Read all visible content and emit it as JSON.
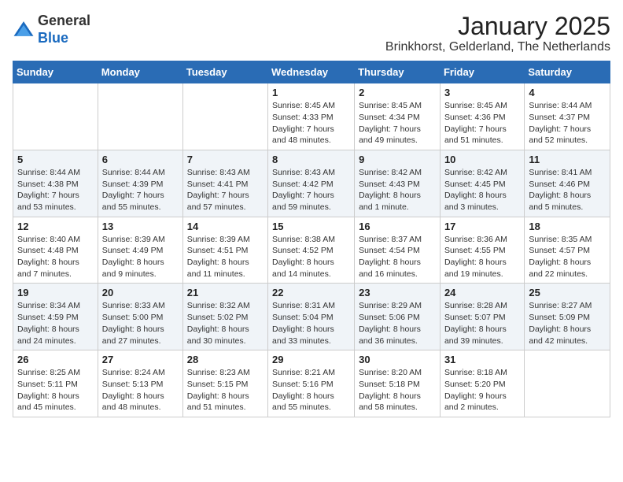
{
  "logo": {
    "general": "General",
    "blue": "Blue"
  },
  "title": "January 2025",
  "location": "Brinkhorst, Gelderland, The Netherlands",
  "days_of_week": [
    "Sunday",
    "Monday",
    "Tuesday",
    "Wednesday",
    "Thursday",
    "Friday",
    "Saturday"
  ],
  "weeks": [
    [
      {
        "day": "",
        "info": ""
      },
      {
        "day": "",
        "info": ""
      },
      {
        "day": "",
        "info": ""
      },
      {
        "day": "1",
        "info": "Sunrise: 8:45 AM\nSunset: 4:33 PM\nDaylight: 7 hours\nand 48 minutes."
      },
      {
        "day": "2",
        "info": "Sunrise: 8:45 AM\nSunset: 4:34 PM\nDaylight: 7 hours\nand 49 minutes."
      },
      {
        "day": "3",
        "info": "Sunrise: 8:45 AM\nSunset: 4:36 PM\nDaylight: 7 hours\nand 51 minutes."
      },
      {
        "day": "4",
        "info": "Sunrise: 8:44 AM\nSunset: 4:37 PM\nDaylight: 7 hours\nand 52 minutes."
      }
    ],
    [
      {
        "day": "5",
        "info": "Sunrise: 8:44 AM\nSunset: 4:38 PM\nDaylight: 7 hours\nand 53 minutes."
      },
      {
        "day": "6",
        "info": "Sunrise: 8:44 AM\nSunset: 4:39 PM\nDaylight: 7 hours\nand 55 minutes."
      },
      {
        "day": "7",
        "info": "Sunrise: 8:43 AM\nSunset: 4:41 PM\nDaylight: 7 hours\nand 57 minutes."
      },
      {
        "day": "8",
        "info": "Sunrise: 8:43 AM\nSunset: 4:42 PM\nDaylight: 7 hours\nand 59 minutes."
      },
      {
        "day": "9",
        "info": "Sunrise: 8:42 AM\nSunset: 4:43 PM\nDaylight: 8 hours\nand 1 minute."
      },
      {
        "day": "10",
        "info": "Sunrise: 8:42 AM\nSunset: 4:45 PM\nDaylight: 8 hours\nand 3 minutes."
      },
      {
        "day": "11",
        "info": "Sunrise: 8:41 AM\nSunset: 4:46 PM\nDaylight: 8 hours\nand 5 minutes."
      }
    ],
    [
      {
        "day": "12",
        "info": "Sunrise: 8:40 AM\nSunset: 4:48 PM\nDaylight: 8 hours\nand 7 minutes."
      },
      {
        "day": "13",
        "info": "Sunrise: 8:39 AM\nSunset: 4:49 PM\nDaylight: 8 hours\nand 9 minutes."
      },
      {
        "day": "14",
        "info": "Sunrise: 8:39 AM\nSunset: 4:51 PM\nDaylight: 8 hours\nand 11 minutes."
      },
      {
        "day": "15",
        "info": "Sunrise: 8:38 AM\nSunset: 4:52 PM\nDaylight: 8 hours\nand 14 minutes."
      },
      {
        "day": "16",
        "info": "Sunrise: 8:37 AM\nSunset: 4:54 PM\nDaylight: 8 hours\nand 16 minutes."
      },
      {
        "day": "17",
        "info": "Sunrise: 8:36 AM\nSunset: 4:55 PM\nDaylight: 8 hours\nand 19 minutes."
      },
      {
        "day": "18",
        "info": "Sunrise: 8:35 AM\nSunset: 4:57 PM\nDaylight: 8 hours\nand 22 minutes."
      }
    ],
    [
      {
        "day": "19",
        "info": "Sunrise: 8:34 AM\nSunset: 4:59 PM\nDaylight: 8 hours\nand 24 minutes."
      },
      {
        "day": "20",
        "info": "Sunrise: 8:33 AM\nSunset: 5:00 PM\nDaylight: 8 hours\nand 27 minutes."
      },
      {
        "day": "21",
        "info": "Sunrise: 8:32 AM\nSunset: 5:02 PM\nDaylight: 8 hours\nand 30 minutes."
      },
      {
        "day": "22",
        "info": "Sunrise: 8:31 AM\nSunset: 5:04 PM\nDaylight: 8 hours\nand 33 minutes."
      },
      {
        "day": "23",
        "info": "Sunrise: 8:29 AM\nSunset: 5:06 PM\nDaylight: 8 hours\nand 36 minutes."
      },
      {
        "day": "24",
        "info": "Sunrise: 8:28 AM\nSunset: 5:07 PM\nDaylight: 8 hours\nand 39 minutes."
      },
      {
        "day": "25",
        "info": "Sunrise: 8:27 AM\nSunset: 5:09 PM\nDaylight: 8 hours\nand 42 minutes."
      }
    ],
    [
      {
        "day": "26",
        "info": "Sunrise: 8:25 AM\nSunset: 5:11 PM\nDaylight: 8 hours\nand 45 minutes."
      },
      {
        "day": "27",
        "info": "Sunrise: 8:24 AM\nSunset: 5:13 PM\nDaylight: 8 hours\nand 48 minutes."
      },
      {
        "day": "28",
        "info": "Sunrise: 8:23 AM\nSunset: 5:15 PM\nDaylight: 8 hours\nand 51 minutes."
      },
      {
        "day": "29",
        "info": "Sunrise: 8:21 AM\nSunset: 5:16 PM\nDaylight: 8 hours\nand 55 minutes."
      },
      {
        "day": "30",
        "info": "Sunrise: 8:20 AM\nSunset: 5:18 PM\nDaylight: 8 hours\nand 58 minutes."
      },
      {
        "day": "31",
        "info": "Sunrise: 8:18 AM\nSunset: 5:20 PM\nDaylight: 9 hours\nand 2 minutes."
      },
      {
        "day": "",
        "info": ""
      }
    ]
  ]
}
